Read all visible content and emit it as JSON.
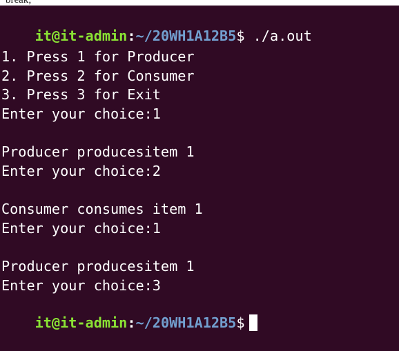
{
  "top_strip_text": "break;",
  "colors": {
    "background": "#300a24",
    "user_host": "#8ae234",
    "path": "#729fcf",
    "text": "#ffffff"
  },
  "prompt_1": {
    "user_host": "it@it-admin",
    "colon": ":",
    "path": "~/20WH1A12B5",
    "dollar": "$",
    "command": " ./a.out"
  },
  "output": {
    "blank_1": "",
    "menu_1": "1. Press 1 for Producer",
    "menu_2": "2. Press 2 for Consumer",
    "menu_3": "3. Press 3 for Exit",
    "choice_1": "Enter your choice:1",
    "blank_2": "",
    "produce_1": "Producer producesitem 1",
    "choice_2": "Enter your choice:2",
    "blank_3": "",
    "consume_1": "Consumer consumes item 1",
    "choice_3": "Enter your choice:1",
    "blank_4": "",
    "produce_2": "Producer producesitem 1",
    "choice_4": "Enter your choice:3"
  },
  "prompt_2": {
    "user_host": "it@it-admin",
    "colon": ":",
    "path": "~/20WH1A12B5",
    "dollar": "$"
  }
}
